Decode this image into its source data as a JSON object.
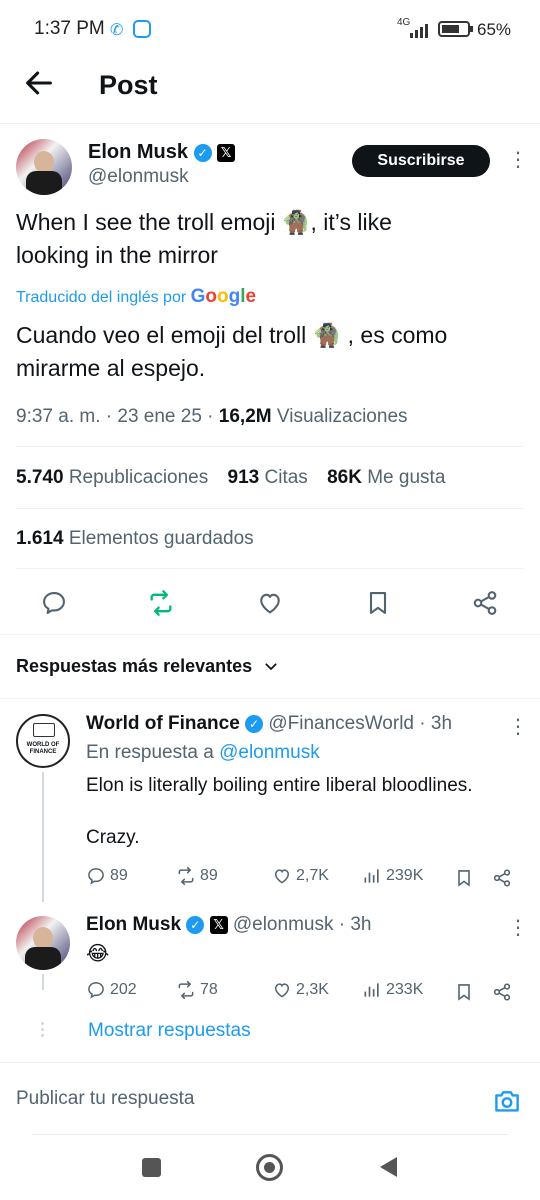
{
  "status_bar": {
    "time": "1:37 PM",
    "network": "4G",
    "battery": "65%"
  },
  "header": {
    "title": "Post"
  },
  "post": {
    "author_name": "Elon Musk",
    "handle": "@elonmusk",
    "subscribe_label": "Suscribirse",
    "text_line1": "When I see the troll emoji 🧌, it’s like",
    "text_line2": "looking in the mirror",
    "translated_by": "Traducido del inglés por",
    "translator": "Google",
    "translated_line1": "Cuando veo el emoji del troll 🧌 , es como",
    "translated_line2": "mirarme al espejo.",
    "timestamp": "9:37 a. m. · 23 ene 25 · ",
    "views_count": "16,2M",
    "views_label": "Visualizaciones",
    "reposts_count": "5.740",
    "reposts_label": "Republicaciones",
    "quotes_count": "913",
    "quotes_label": "Citas",
    "likes_count": "86K",
    "likes_label": "Me gusta",
    "bookmarks_count": "1.614",
    "bookmarks_label": "Elementos guardados"
  },
  "replies_section": {
    "sort_label": "Respuestas más relevantes"
  },
  "replies": [
    {
      "author_name": "World of Finance",
      "handle": "@FinancesWorld",
      "time": "· 3h",
      "avatar_text": "WORLD OF FINANCE",
      "reply_to_prefix": "En respuesta a",
      "reply_to_handle": "@elonmusk",
      "text_line1": "Elon is literally boiling entire liberal bloodlines.",
      "text_line2": "Crazy.",
      "replies": "89",
      "reposts": "89",
      "likes": "2,7K",
      "views": "239K"
    },
    {
      "author_name": "Elon Musk",
      "handle": "@elonmusk",
      "time": "· 3h",
      "text_line1": "😂",
      "replies": "202",
      "reposts": "78",
      "likes": "2,3K",
      "views": "233K",
      "show_replies": "Mostrar respuestas"
    }
  ],
  "composer": {
    "placeholder": "Publicar tu respuesta"
  },
  "colors": {
    "accent": "#1d9bf0",
    "repost_active": "#00ba7c",
    "text": "#0f1419",
    "muted": "#536471"
  }
}
